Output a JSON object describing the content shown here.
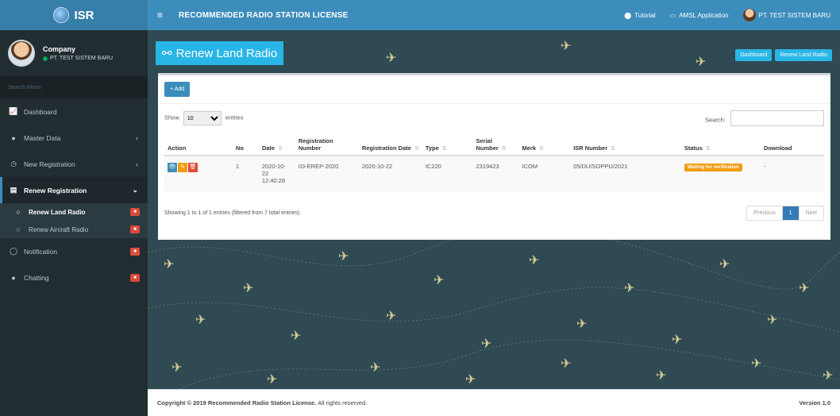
{
  "app": {
    "logo_text": "ISR",
    "title": "RECOMMENDED RADIO STATION LICENSE"
  },
  "topbar": {
    "tutorial": "Tutorial",
    "amsl": "AMSL Application",
    "user": "PT. TEST SISTEM BARU"
  },
  "user_panel": {
    "name": "Company",
    "status": "PT. TEST SISTEM BARU"
  },
  "sidebar": {
    "search_placeholder": "Search Menu",
    "items": [
      {
        "label": "Dashboard",
        "icon": "line-chart-icon"
      },
      {
        "label": "Master Data",
        "icon": "database-icon"
      },
      {
        "label": "New Registration",
        "icon": "registration-icon"
      },
      {
        "label": "Renew Registration",
        "icon": "file-icon"
      }
    ],
    "submenu": [
      {
        "label": "Renew Land Radio",
        "badge": ""
      },
      {
        "label": "Renew Aircraft Radio",
        "badge": ""
      }
    ],
    "notification": "Notification",
    "chatting": "Chatting"
  },
  "page": {
    "header": "Renew Land Radio",
    "breadcrumb": [
      "Dashboard",
      "Renew Land Radio"
    ],
    "add_label": "Add",
    "show_label": "Show",
    "entries_value": "10",
    "entries_label": "entries",
    "search_label": "Search:",
    "columns": [
      "Action",
      "No",
      "Date",
      "Registration Number",
      "Registration Date",
      "Type",
      "Serial Number",
      "Merk",
      "ISR Number",
      "Status",
      "Download"
    ],
    "rows": [
      {
        "no": "1",
        "date": "2020-10-22 12:40:28",
        "reg_number": "03-EREP-2020",
        "reg_date": "2020-10-22",
        "type": "IC220",
        "serial": "2319423",
        "merk": "ICOM",
        "isr": "05/DU/SOPPU/2021",
        "status": "Waiting for verification",
        "download": "-"
      }
    ],
    "info": "Showing 1 to 1 of 1 entries (filtered from 7 total entries)",
    "pager": {
      "prev": "Previous",
      "current": "1",
      "next": "Next"
    }
  },
  "footer": {
    "copyright": "Copyright © 2019 Recommended Radio Station License.",
    "rights": "All rights reserved.",
    "version": "Version 1.0"
  },
  "colors": {
    "primary": "#3c8dbc",
    "sidebar": "#222d32",
    "accent": "#29b6e6",
    "warning": "#f39c12",
    "danger": "#dd4b39"
  }
}
